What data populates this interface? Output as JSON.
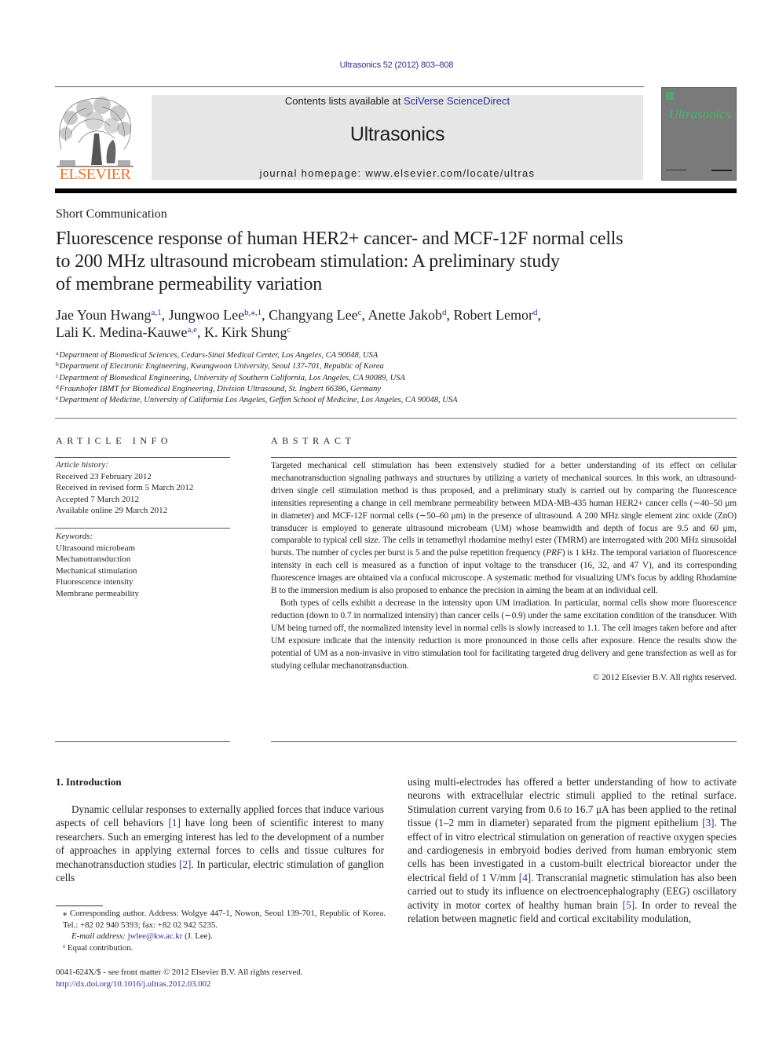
{
  "header": {
    "journal_ref": "Ultrasonics 52 (2012) 803–808",
    "contents_prefix": "Contents lists available at ",
    "contents_link": "SciVerse ScienceDirect",
    "journal_name": "Ultrasonics",
    "homepage_prefix": "journal homepage: ",
    "homepage_url": "www.elsevier.com/locate/ultras",
    "publisher_logo_text": "ELSEVIER",
    "cover_title": "Ultrasonics",
    "colors": {
      "link": "#2e3192",
      "elsevier_orange": "#f37021",
      "cover_bg": "#7a7a7a",
      "cover_title": "#3dbb6a",
      "masthead_bg": "#e6e6e6"
    }
  },
  "article": {
    "type": "Short Communication",
    "title_lines": [
      "Fluorescence response of human HER2+ cancer- and MCF-12F normal cells",
      "to 200 MHz ultrasound microbeam stimulation: A preliminary study",
      "of membrane permeability variation"
    ],
    "authors": [
      {
        "name": "Jae Youn Hwang",
        "sup": "a,1",
        "sep": ", "
      },
      {
        "name": "Jungwoo Lee",
        "sup": "b,⁎,1",
        "sep": ", "
      },
      {
        "name": "Changyang Lee",
        "sup": "c",
        "sep": ", "
      },
      {
        "name": "Anette Jakob",
        "sup": "d",
        "sep": ", "
      },
      {
        "name": "Robert Lemor",
        "sup": "d",
        "sep": ","
      },
      {
        "name": "Lali K. Medina-Kauwe",
        "sup": "a,e",
        "sep": ", "
      },
      {
        "name": "K. Kirk Shung",
        "sup": "c",
        "sep": ""
      }
    ],
    "affiliations": [
      {
        "key": "a",
        "text": "Department of Biomedical Sciences, Cedars-Sinai Medical Center, Los Angeles, CA 90048, USA"
      },
      {
        "key": "b",
        "text": "Department of Electronic Engineering, Kwangwoon University, Seoul 137-701, Republic of Korea"
      },
      {
        "key": "c",
        "text": "Department of Biomedical Engineering, University of Southern California, Los Angeles, CA 90089, USA"
      },
      {
        "key": "d",
        "text": "Fraunhofer IBMT for Biomedical Engineering, Division Ultrasound, St. Ingbert 66386, Germany"
      },
      {
        "key": "e",
        "text": "Department of Medicine, University of California Los Angeles, Geffen School of Medicine, Los Angeles, CA 90048, USA"
      }
    ]
  },
  "article_info": {
    "heading": "ARTICLE INFO",
    "history_label": "Article history:",
    "history": [
      "Received 23 February 2012",
      "Received in revised form 5 March 2012",
      "Accepted 7 March 2012",
      "Available online 29 March 2012"
    ],
    "keywords_label": "Keywords:",
    "keywords": [
      "Ultrasound microbeam",
      "Mechanotransduction",
      "Mechanical stimulation",
      "Fluorescence intensity",
      "Membrane permeability"
    ]
  },
  "abstract": {
    "heading": "ABSTRACT",
    "paragraphs": [
      "Targeted mechanical cell stimulation has been extensively studied for a better understanding of its effect on cellular mechanotransduction signaling pathways and structures by utilizing a variety of mechanical sources. In this work, an ultrasound-driven single cell stimulation method is thus proposed, and a preliminary study is carried out by comparing the fluorescence intensities representing a change in cell membrane permeability between MDA-MB-435 human HER2+ cancer cells (∼40–50 μm in diameter) and MCF-12F normal cells (∼50–60 μm) in the presence of ultrasound. A 200 MHz single element zinc oxide (ZnO) transducer is employed to generate ultrasound microbeam (UM) whose beamwidth and depth of focus are 9.5 and 60 μm, comparable to typical cell size. The cells in tetramethyl rhodamine methyl ester (TMRM) are interrogated with 200 MHz sinusoidal bursts. The number of cycles per burst is 5 and the pulse repetition frequency (PRF) is 1 kHz. The temporal variation of fluorescence intensity in each cell is measured as a function of input voltage to the transducer (16, 32, and 47 V), and its corresponding fluorescence images are obtained via a confocal microscope. A systematic method for visualizing UM's focus by adding Rhodamine B to the immersion medium is also proposed to enhance the precision in aiming the beam at an individual cell.",
      "Both types of cells exhibit a decrease in the intensity upon UM irradiation. In particular, normal cells show more fluorescence reduction (down to 0.7 in normalized intensity) than cancer cells (∼0.9) under the same excitation condition of the transducer. With UM being turned off, the normalized intensity level in normal cells is slowly increased to 1.1. The cell images taken before and after UM exposure indicate that the intensity reduction is more pronounced in those cells after exposure. Hence the results show the potential of UM as a non-invasive in vitro stimulation tool for facilitating targeted drug delivery and gene transfection as well as for studying cellular mechanotransduction."
    ],
    "copyright": "© 2012 Elsevier B.V. All rights reserved."
  },
  "introduction": {
    "heading": "1. Introduction",
    "col1": [
      {
        "t": "Dynamic cellular responses to externally applied forces that induce various aspects of cell behaviors "
      },
      {
        "ref": "[1]"
      },
      {
        "t": " have long been of scientific interest to many researchers. Such an emerging interest has led to the development of a number of approaches in applying external forces to cells and tissue cultures for mechanotransduction studies "
      },
      {
        "ref": "[2]"
      },
      {
        "t": ". In particular, electric stimulation of ganglion cells"
      }
    ],
    "col2": [
      {
        "t": "using multi-electrodes has offered a better understanding of how to activate neurons with extracellular electric stimuli applied to the retinal surface. Stimulation current varying from 0.6 to 16.7 μA has been applied to the retinal tissue (1–2 mm in diameter) separated from the pigment epithelium "
      },
      {
        "ref": "[3]"
      },
      {
        "t": ". The effect of in vitro electrical stimulation on generation of reactive oxygen species and cardiogenesis in embryoid bodies derived from human embryonic stem cells has been investigated in a custom-built electrical bioreactor under the electrical field of 1 V/mm "
      },
      {
        "ref": "[4]"
      },
      {
        "t": ". Transcranial magnetic stimulation has also been carried out to study its influence on electroencephalography (EEG) oscillatory activity in motor cortex of healthy human brain "
      },
      {
        "ref": "[5]"
      },
      {
        "t": ". In order to reveal the relation between magnetic field and cortical excitability modulation,"
      }
    ]
  },
  "footnotes": {
    "corresponding": "⁎  Corresponding author. Address: Wolgye 447-1, Nowon, Seoul 139-701, Republic of Korea. Tel.: +82 02 940 5393; fax: +82 02 942 5235.",
    "email_label": "E-mail address: ",
    "email": "jwlee@kw.ac.kr",
    "email_suffix": " (J. Lee).",
    "equal": "¹  Equal contribution."
  },
  "front_matter": {
    "issn_line": "0041-624X/$ - see front matter © 2012 Elsevier B.V. All rights reserved.",
    "doi": "http://dx.doi.org/10.1016/j.ultras.2012.03.002"
  }
}
